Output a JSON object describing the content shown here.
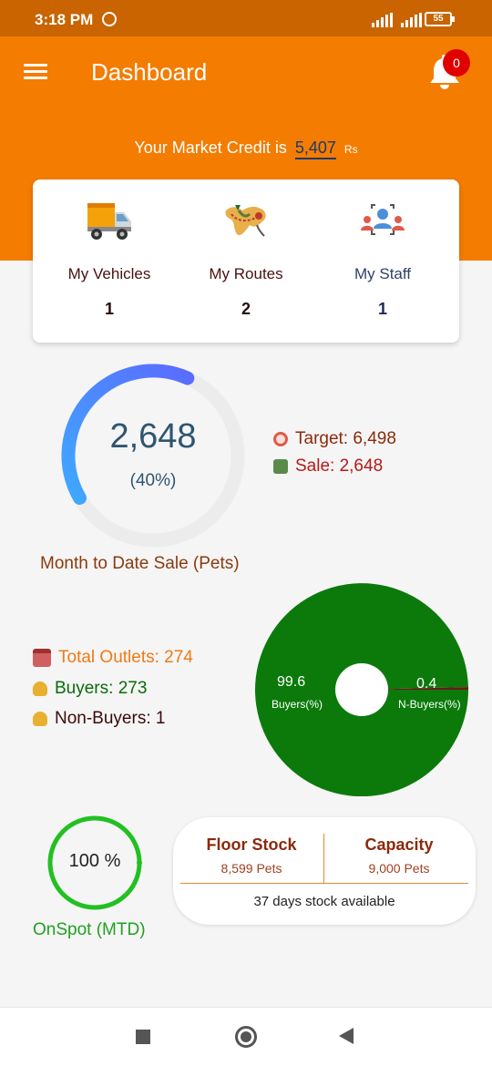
{
  "status_bar": {
    "time": "3:18 PM",
    "battery": "55"
  },
  "app_bar": {
    "title": "Dashboard",
    "notification_count": "0"
  },
  "credit": {
    "prefix": "Your Market Credit is",
    "value": "5,407",
    "unit": "Rs"
  },
  "summary_cards": [
    {
      "label": "My Vehicles",
      "count": "1",
      "icon": "truck-icon"
    },
    {
      "label": "My Routes",
      "count": "2",
      "icon": "map-route-icon"
    },
    {
      "label": "My Staff",
      "count": "1",
      "icon": "staff-icon"
    }
  ],
  "sale_gauge": {
    "value": "2,648",
    "percent_text": "(40%)",
    "fraction": 0.4,
    "caption": "Month to Date Sale (Pets)",
    "target": "Target: 6,498",
    "sale": "Sale: 2,648"
  },
  "outlets": {
    "total": "Total Outlets: 274",
    "buyers": "Buyers: 273",
    "non_buyers": "Non-Buyers: 1"
  },
  "chart_data": {
    "type": "pie",
    "slices": [
      {
        "label": "Buyers(%)",
        "value": 99.6,
        "color": "#0b7a0b"
      },
      {
        "label": "N-Buyers(%)",
        "value": 0.4,
        "color": "#6b1a1a"
      }
    ],
    "value_labels": [
      "99.6",
      "0.4"
    ]
  },
  "onspot": {
    "value": "100 %",
    "caption": "OnSpot (MTD)",
    "fraction": 1.0
  },
  "stock": {
    "floor_title": "Floor Stock",
    "floor_value": "8,599 Pets",
    "capacity_title": "Capacity",
    "capacity_value": "9,000 Pets",
    "note": "37 days stock available"
  },
  "colors": {
    "primary": "#f47c00",
    "status": "#c96400",
    "gauge": "#4a86ff",
    "green": "#0b7a0b",
    "onspot": "#22c022"
  }
}
